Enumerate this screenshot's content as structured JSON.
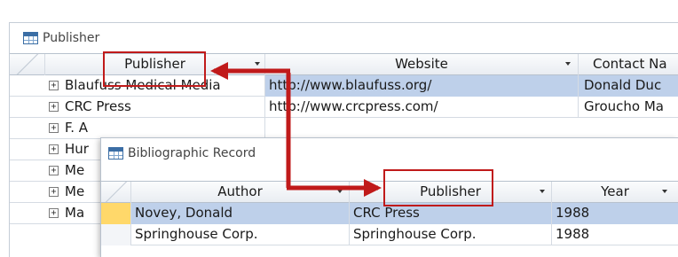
{
  "window_publisher": {
    "title": "Publisher",
    "columns": [
      "Publisher",
      "Website",
      "Contact Na"
    ],
    "rows": [
      {
        "expander": "+",
        "publisher": "Blaufuss Medical Media",
        "website": "http://www.blaufuss.org/",
        "contact": "Donald Duc"
      },
      {
        "expander": "+",
        "publisher": "CRC Press",
        "website": "http://www.crcpress.com/",
        "contact": "Groucho Ma"
      },
      {
        "expander": "+",
        "publisher": "F. A",
        "website": "",
        "contact": ""
      },
      {
        "expander": "+",
        "publisher": "Hur",
        "website": "",
        "contact": ""
      },
      {
        "expander": "+",
        "publisher": "Me",
        "website": "",
        "contact": ""
      },
      {
        "expander": "+",
        "publisher": "Me",
        "website": "",
        "contact": ""
      },
      {
        "expander": "+",
        "publisher": "Ma",
        "website": "",
        "contact": ""
      }
    ]
  },
  "window_biblio": {
    "title": "Bibliographic Record",
    "columns": [
      "Author",
      "Publisher",
      "Year"
    ],
    "rows": [
      {
        "author": "Novey, Donald",
        "publisher": "CRC Press",
        "year": "1988"
      },
      {
        "author": "Springhouse Corp.",
        "publisher": "Springhouse Corp.",
        "year": "1988"
      }
    ]
  },
  "annotation": {
    "color": "#c01a1a",
    "selection_color": "#bed0ea",
    "record_selector_color": "#ffd86a"
  }
}
